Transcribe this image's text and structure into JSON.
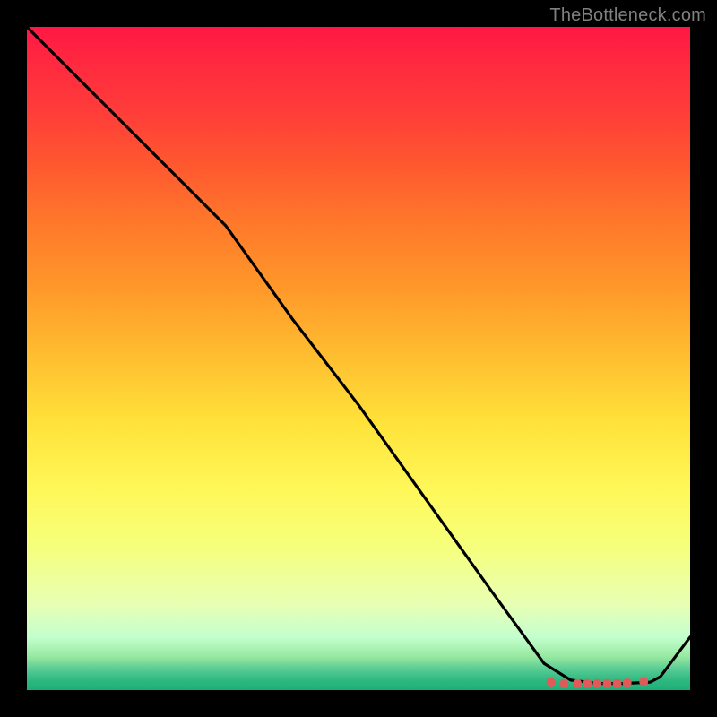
{
  "attribution": "TheBottleneck.com",
  "chart_data": {
    "type": "line",
    "title": "",
    "xlabel": "",
    "ylabel": "",
    "xlim": [
      0,
      100
    ],
    "ylim": [
      0,
      100
    ],
    "series": [
      {
        "name": "curve",
        "x": [
          0,
          8,
          20,
          26,
          30,
          40,
          50,
          60,
          70,
          78,
          82,
          86,
          90,
          94,
          95.5,
          100
        ],
        "values": [
          100,
          92,
          80,
          74,
          70,
          56,
          43,
          29,
          15,
          4,
          1.5,
          1,
          1,
          1.2,
          2,
          8
        ]
      }
    ],
    "markers": {
      "name": "flat-markers",
      "x": [
        79,
        81,
        83,
        84.5,
        86,
        87.5,
        89,
        90.5,
        93
      ],
      "values": [
        1.2,
        1.0,
        1.0,
        1.0,
        1.0,
        1.0,
        1.0,
        1.1,
        1.3
      ],
      "color": "#e05a5a",
      "radius": 5
    }
  }
}
